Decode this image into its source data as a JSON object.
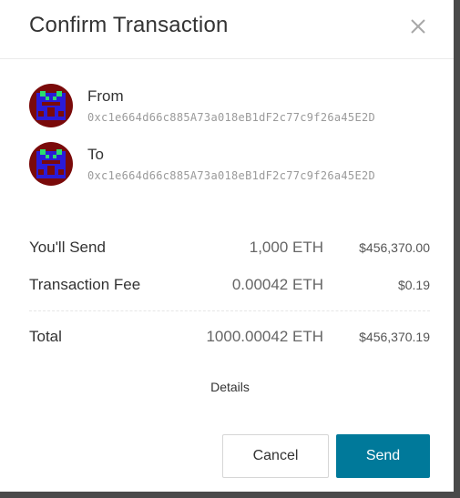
{
  "dialog": {
    "title": "Confirm Transaction"
  },
  "from": {
    "label": "From",
    "address": "0xc1e664d66c885A73a018eB1dF2c77c9f26a45E2D"
  },
  "to": {
    "label": "To",
    "address": "0xc1e664d66c885A73a018eB1dF2c77c9f26a45E2D"
  },
  "summary": {
    "send": {
      "label": "You'll Send",
      "eth": "1,000 ETH",
      "usd": "$456,370.00"
    },
    "fee": {
      "label": "Transaction Fee",
      "eth": "0.00042 ETH",
      "usd": "$0.19"
    },
    "total": {
      "label": "Total",
      "eth": "1000.00042 ETH",
      "usd": "$456,370.19"
    }
  },
  "details_label": "Details",
  "buttons": {
    "cancel": "Cancel",
    "send": "Send"
  },
  "colors": {
    "primary": "#00799a",
    "avatar_bg": "#7a0a0a",
    "avatar_face": "#2b1bd8",
    "avatar_eye": "#2bdc6e"
  }
}
